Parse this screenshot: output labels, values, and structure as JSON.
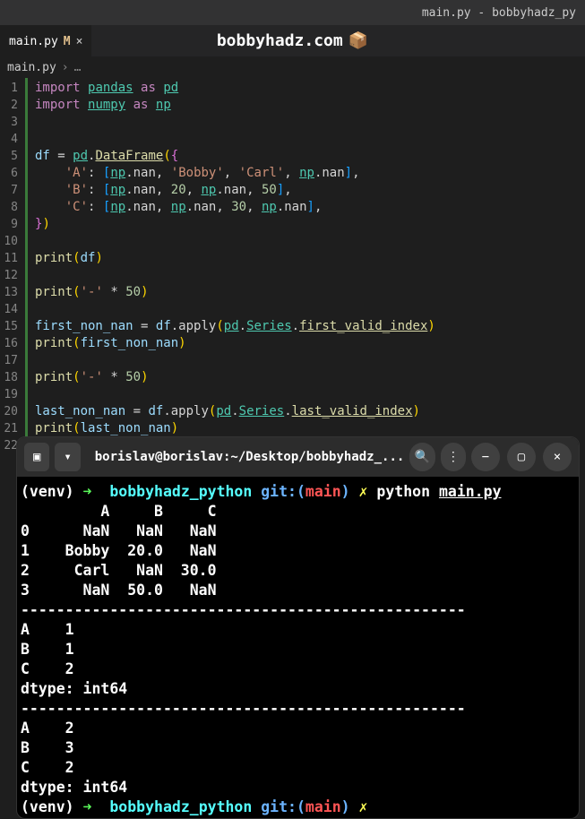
{
  "window": {
    "title": "main.py - bobbyhadz_py"
  },
  "tab": {
    "name": "main.py",
    "modified": "M"
  },
  "watermark": "bobbyhadz.com",
  "breadcrumb": {
    "file": "main.py",
    "sep": "›",
    "more": "…"
  },
  "gutter": [
    "1",
    "2",
    "3",
    "4",
    "5",
    "6",
    "7",
    "8",
    "9",
    "10",
    "11",
    "12",
    "13",
    "14",
    "15",
    "16",
    "17",
    "18",
    "19",
    "20",
    "21",
    "22"
  ],
  "code": {
    "l1": {
      "import": "import",
      "pandas": "pandas",
      "as": "as",
      "pd": "pd"
    },
    "l2": {
      "import": "import",
      "numpy": "numpy",
      "as": "as",
      "np": "np"
    },
    "l5": {
      "df": "df",
      "eq": "=",
      "pd": "pd",
      "dot": ".",
      "DataFrame": "DataFrame",
      "open": "(",
      "brace": "{"
    },
    "l6": {
      "key": "'A'",
      "colon": ":",
      "lb": "[",
      "np1": "np",
      "nan": ".nan,",
      "bobby": "'Bobby'",
      "carl": "'Carl'",
      "np2": "np",
      "nan2": ".nan",
      "rb": "]",
      "comma": ","
    },
    "l7": {
      "key": "'B'",
      "colon": ":",
      "lb": "[",
      "np1": "np",
      "nan1": ".nan,",
      "n20": "20",
      "np2": "np",
      "nan2": ".nan,",
      "n50": "50",
      "rb": "]",
      "comma": ","
    },
    "l8": {
      "key": "'C'",
      "colon": ":",
      "lb": "[",
      "np1": "np",
      "nan1": ".nan,",
      "np2": "np",
      "nan2": ".nan,",
      "n30": "30",
      "np3": "np",
      "nan3": ".nan",
      "rb": "]",
      "comma": ","
    },
    "l9": {
      "brace": "}",
      "close": ")"
    },
    "l11": {
      "print": "print",
      "open": "(",
      "df": "df",
      "close": ")"
    },
    "l13": {
      "print": "print",
      "open": "(",
      "str": "'-'",
      "mul": "*",
      "n": "50",
      "close": ")"
    },
    "l15": {
      "var": "first_non_nan",
      "eq": "=",
      "df": "df",
      "apply": ".apply",
      "open": "(",
      "pd": "pd",
      "dot": ".",
      "Series": "Series",
      "dot2": ".",
      "meth": "first_valid_index",
      "close": ")"
    },
    "l16": {
      "print": "print",
      "open": "(",
      "var": "first_non_nan",
      "close": ")"
    },
    "l18": {
      "print": "print",
      "open": "(",
      "str": "'-'",
      "mul": "*",
      "n": "50",
      "close": ")"
    },
    "l20": {
      "var": "last_non_nan",
      "eq": "=",
      "df": "df",
      "apply": ".apply",
      "open": "(",
      "pd": "pd",
      "dot": ".",
      "Series": "Series",
      "dot2": ".",
      "meth": "last_valid_index",
      "close": ")"
    },
    "l21": {
      "print": "print",
      "open": "(",
      "var": "last_non_nan",
      "close": ")"
    }
  },
  "terminal": {
    "title": "borislav@borislav:~/Desktop/bobbyhadz_...",
    "prompt": {
      "venv": "(venv)",
      "arrow": "➜",
      "dir": "bobbyhadz_python",
      "git": "git:(",
      "branch": "main",
      "gitclose": ")",
      "dirty": "✗",
      "cmd": "python",
      "file": "main.py"
    },
    "output": "         A     B     C\n0      NaN   NaN   NaN\n1    Bobby  20.0   NaN\n2     Carl   NaN  30.0\n3      NaN  50.0   NaN\n--------------------------------------------------\nA    1\nB    1\nC    2\ndtype: int64\n--------------------------------------------------\nA    2\nB    3\nC    2\ndtype: int64"
  }
}
